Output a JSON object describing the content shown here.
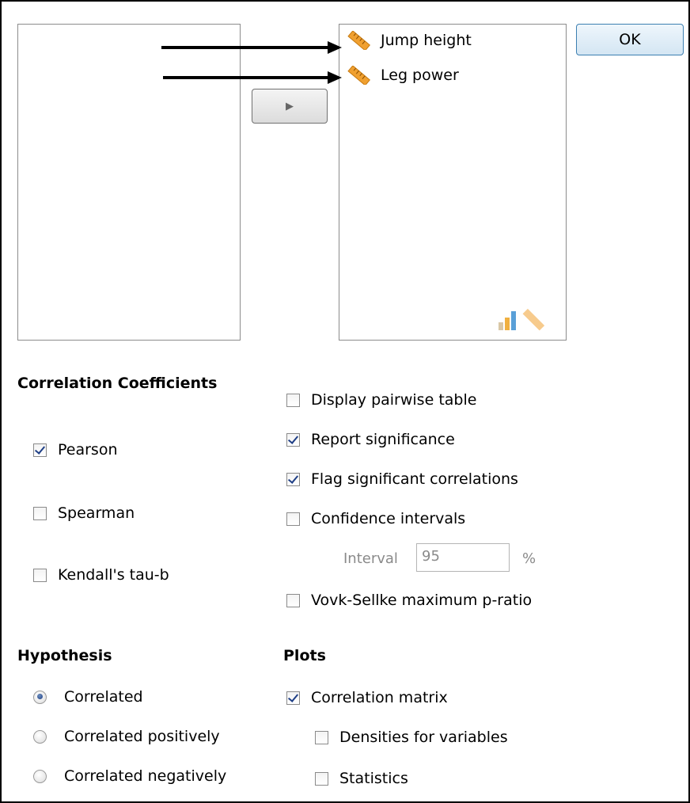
{
  "buttons": {
    "ok_label": "OK",
    "move_arrow": "▶"
  },
  "variables": [
    {
      "name": "Jump height",
      "icon": "scale-ruler-icon"
    },
    {
      "name": "Leg power",
      "icon": "scale-ruler-icon"
    }
  ],
  "target_list": {
    "allowed_types_icons": [
      "ordinal-bar-icon",
      "scale-ruler-icon"
    ]
  },
  "correlation_coefficients": {
    "heading": "Correlation Coefficients",
    "items": [
      {
        "label": "Pearson",
        "checked": true
      },
      {
        "label": "Spearman",
        "checked": false
      },
      {
        "label": "Kendall's tau-b",
        "checked": false
      }
    ]
  },
  "options": {
    "items": [
      {
        "label": "Display pairwise table",
        "checked": false
      },
      {
        "label": "Report significance",
        "checked": true
      },
      {
        "label": "Flag significant correlations",
        "checked": true
      },
      {
        "label": "Confidence intervals",
        "checked": false
      }
    ],
    "interval_label": "Interval",
    "interval_value": "95",
    "interval_unit": "%",
    "vovk_label": "Vovk-Sellke maximum p-ratio",
    "vovk_checked": false
  },
  "hypothesis": {
    "heading": "Hypothesis",
    "items": [
      {
        "label": "Correlated",
        "selected": true
      },
      {
        "label": "Correlated positively",
        "selected": false
      },
      {
        "label": "Correlated negatively",
        "selected": false
      }
    ]
  },
  "plots": {
    "heading": "Plots",
    "correlation_matrix": {
      "label": "Correlation matrix",
      "checked": true
    },
    "densities": {
      "label": "Densities for variables",
      "checked": false
    },
    "statistics": {
      "label": "Statistics",
      "checked": false
    }
  },
  "colors": {
    "ruler_orange": "#f0a030",
    "check_blue": "#1f3f86",
    "annotation_arrow": "#000000"
  }
}
